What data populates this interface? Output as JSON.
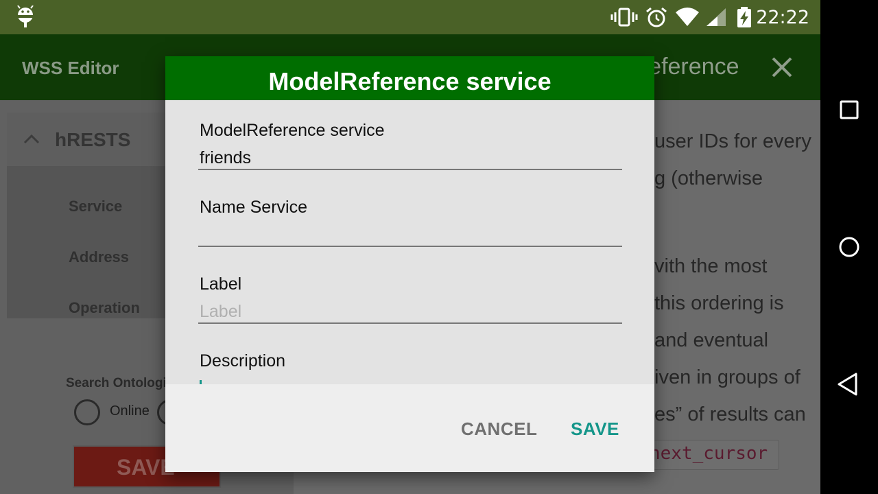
{
  "status_bar": {
    "time": "22:22",
    "icons": [
      "android-debug-icon",
      "vibrate-icon",
      "alarm-icon",
      "wifi-icon",
      "signal-icon",
      "battery-charging-icon"
    ]
  },
  "app_bar": {
    "title": "WSS Editor",
    "background_subtitle": "ModelReference",
    "close_icon": "close-icon"
  },
  "sidebar": {
    "header": "hRESTS",
    "items": [
      {
        "label": "Service"
      },
      {
        "label": "Address"
      },
      {
        "label": "Operation"
      }
    ],
    "search_label": "Search Ontologies",
    "radio_options": [
      {
        "label": "Online",
        "selected": false
      }
    ],
    "save_label": "SAVE"
  },
  "document": {
    "lines": [
      "user IDs for every",
      "g (otherwise",
      "vith the most",
      "this ordering is",
      "and eventual",
      "iven in groups of",
      "es” of results can"
    ],
    "code": "next_cursor"
  },
  "dialog": {
    "title": "ModelReference service",
    "fields": [
      {
        "label": "ModelReference service",
        "value": "friends",
        "placeholder": ""
      },
      {
        "label": "Name Service",
        "value": "",
        "placeholder": ""
      },
      {
        "label": "Label",
        "value": "",
        "placeholder": "Label"
      },
      {
        "label": "Description",
        "value": "",
        "placeholder": ""
      }
    ],
    "cancel_label": "CANCEL",
    "save_label": "SAVE"
  },
  "nav_bar": {
    "icons": [
      "recents-square-icon",
      "home-circle-icon",
      "back-triangle-icon"
    ]
  },
  "colors": {
    "status_bar": "#4a6127",
    "app_bar": "#0f3a06",
    "dialog_header": "#006e00",
    "accent": "#15968a"
  }
}
